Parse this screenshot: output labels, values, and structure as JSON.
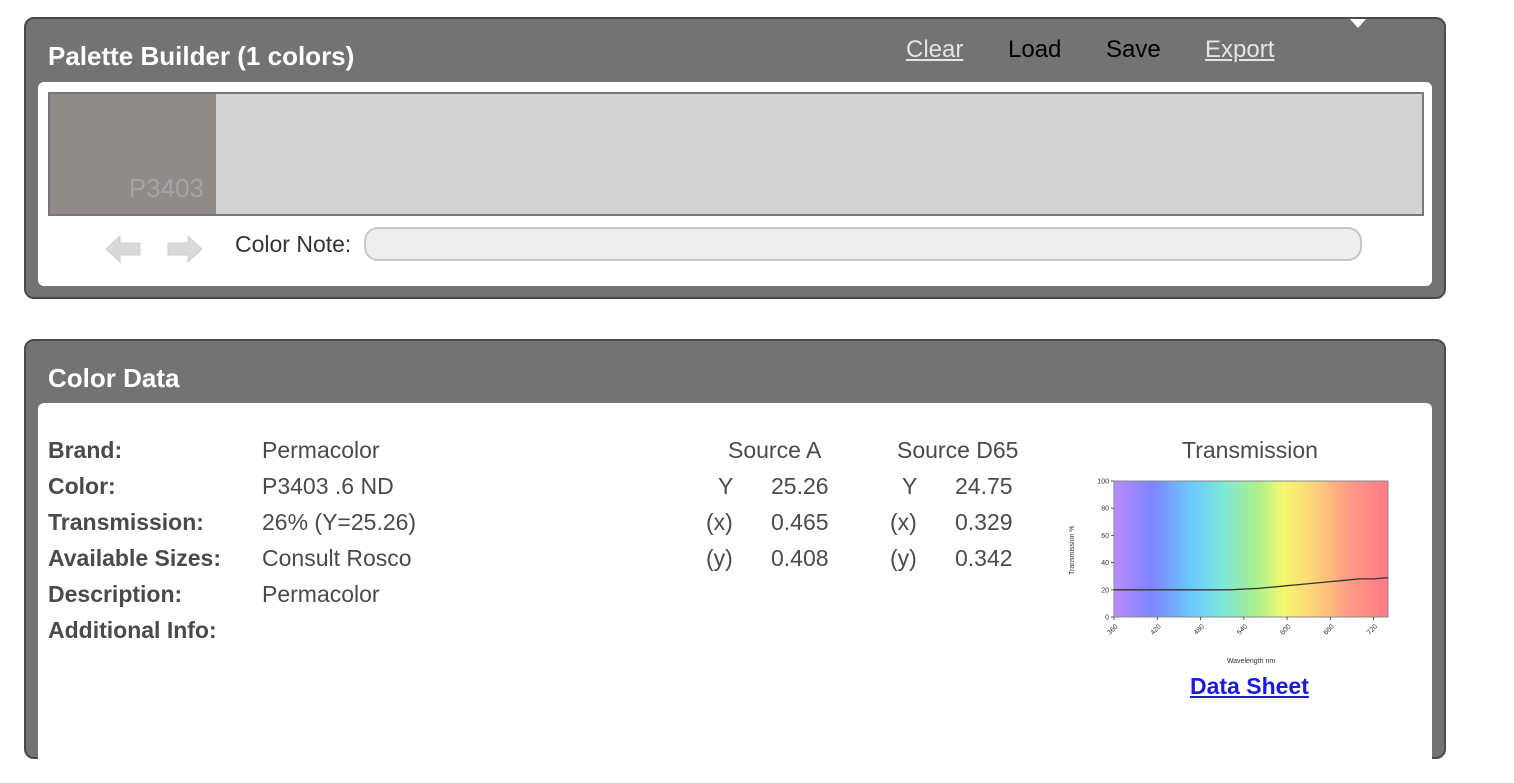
{
  "palette": {
    "title": "Palette Builder (1 colors)",
    "menu": {
      "clear": "Clear",
      "load": "Load",
      "save": "Save",
      "export": "Export"
    },
    "swatch": {
      "label": "P3403",
      "color": "#8f8b8b"
    },
    "note_label": "Color Note:",
    "note_value": ""
  },
  "color_data": {
    "title": "Color Data",
    "fields": [
      {
        "label": "Brand:",
        "value": "Permacolor"
      },
      {
        "label": "Color:",
        "value": "P3403 .6 ND"
      },
      {
        "label": "Transmission:",
        "value": "26% (Y=25.26)"
      },
      {
        "label": "Available Sizes:",
        "value": "Consult Rosco"
      },
      {
        "label": "Description:",
        "value": "Permacolor"
      },
      {
        "label": "Additional Info:",
        "value": ""
      }
    ],
    "source_a": {
      "title": "Source A",
      "rows": [
        {
          "k": "Y",
          "v": "25.26"
        },
        {
          "k": "(x)",
          "v": "0.465"
        },
        {
          "k": "(y)",
          "v": "0.408"
        }
      ]
    },
    "source_d65": {
      "title": "Source D65",
      "rows": [
        {
          "k": "Y",
          "v": "24.75"
        },
        {
          "k": "(x)",
          "v": "0.329"
        },
        {
          "k": "(y)",
          "v": "0.342"
        }
      ]
    },
    "transmission_title": "Transmission",
    "data_sheet_link": "Data Sheet"
  },
  "chart_data": {
    "type": "line",
    "title": "",
    "xlabel": "Wavelength nm",
    "ylabel": "Transmission %",
    "xlim": [
      360,
      740
    ],
    "ylim": [
      0,
      100
    ],
    "x_ticks": [
      "360",
      "420",
      "480",
      "540",
      "600",
      "660",
      "720"
    ],
    "y_ticks": [
      "0",
      "20",
      "40",
      "60",
      "80",
      "100"
    ],
    "series": [
      {
        "x": [
          360,
          400,
          440,
          480,
          520,
          560,
          580,
          600,
          620,
          640,
          660,
          680,
          700,
          720,
          740
        ],
        "y": [
          20,
          20,
          20,
          20,
          20,
          21,
          22,
          23,
          24,
          25,
          26,
          27,
          28,
          28,
          29
        ]
      }
    ],
    "grid": false
  }
}
